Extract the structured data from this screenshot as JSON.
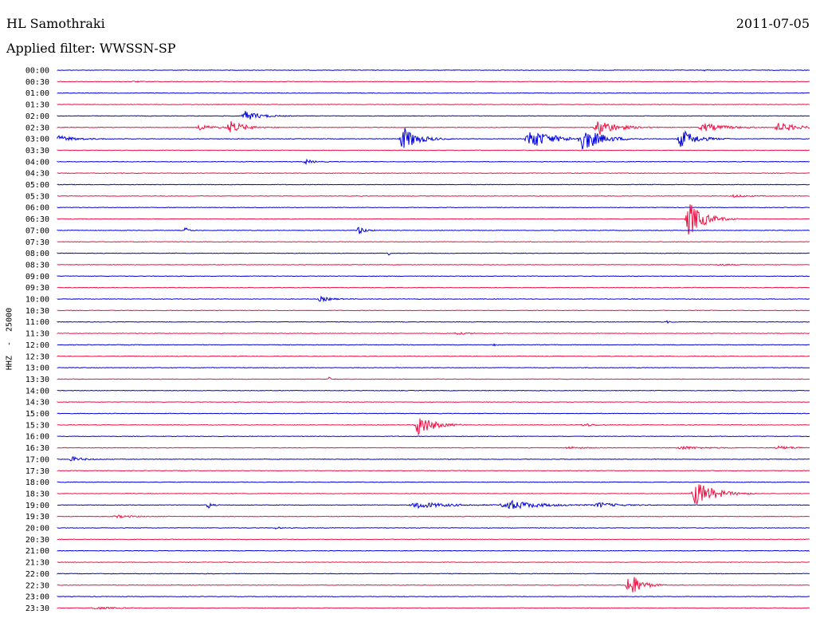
{
  "header": {
    "station": "HL Samothraki",
    "date": "2011-07-05",
    "filter": "Applied filter: WWSSN-SP"
  },
  "colors": {
    "blue": "#0000dd",
    "red": "#ee1144"
  },
  "chart_data": {
    "type": "helicorder",
    "channel_label": "HHZ  -  25000",
    "rows": [
      {
        "label": "00:00",
        "color": "blue",
        "bursts": [
          [
            0.86,
            0.8,
            0.01
          ]
        ]
      },
      {
        "label": "00:30",
        "color": "red",
        "bursts": [
          [
            0.1,
            0.5,
            0.05
          ]
        ]
      },
      {
        "label": "01:00",
        "color": "blue",
        "bursts": []
      },
      {
        "label": "01:30",
        "color": "red",
        "bursts": []
      },
      {
        "label": "02:00",
        "color": "blue",
        "bursts": [
          [
            0.25,
            6,
            0.04
          ]
        ]
      },
      {
        "label": "02:30",
        "color": "red",
        "bursts": [
          [
            0.23,
            8,
            0.04
          ],
          [
            0.19,
            3,
            0.04
          ],
          [
            0.72,
            10,
            0.05
          ],
          [
            0.86,
            5,
            0.06
          ],
          [
            0.96,
            6,
            0.05
          ]
        ]
      },
      {
        "label": "03:00",
        "color": "blue",
        "bursts": [
          [
            0.0,
            4,
            0.05
          ],
          [
            0.46,
            15,
            0.04
          ],
          [
            0.63,
            12,
            0.06
          ],
          [
            0.7,
            14,
            0.05
          ],
          [
            0.83,
            12,
            0.04
          ]
        ]
      },
      {
        "label": "03:30",
        "color": "red",
        "bursts": []
      },
      {
        "label": "04:00",
        "color": "blue",
        "bursts": [
          [
            0.33,
            3,
            0.02
          ]
        ]
      },
      {
        "label": "04:30",
        "color": "red",
        "bursts": []
      },
      {
        "label": "05:00",
        "color": "blue",
        "bursts": []
      },
      {
        "label": "05:30",
        "color": "red",
        "bursts": [
          [
            0.9,
            1.5,
            0.04
          ]
        ]
      },
      {
        "label": "06:00",
        "color": "blue",
        "bursts": []
      },
      {
        "label": "06:30",
        "color": "red",
        "bursts": [
          [
            0.84,
            22,
            0.04
          ]
        ]
      },
      {
        "label": "07:00",
        "color": "blue",
        "bursts": [
          [
            0.17,
            4,
            0.01
          ],
          [
            0.4,
            5,
            0.02
          ]
        ]
      },
      {
        "label": "07:30",
        "color": "red",
        "bursts": []
      },
      {
        "label": "08:00",
        "color": "blue",
        "bursts": [
          [
            0.44,
            3,
            0.005
          ]
        ]
      },
      {
        "label": "08:30",
        "color": "red",
        "bursts": [
          [
            0.88,
            1.5,
            0.03
          ]
        ]
      },
      {
        "label": "09:00",
        "color": "blue",
        "bursts": []
      },
      {
        "label": "09:30",
        "color": "red",
        "bursts": []
      },
      {
        "label": "10:00",
        "color": "blue",
        "bursts": [
          [
            0.35,
            3,
            0.03
          ]
        ]
      },
      {
        "label": "10:30",
        "color": "red",
        "bursts": []
      },
      {
        "label": "11:00",
        "color": "blue",
        "bursts": [
          [
            0.81,
            1.5,
            0.01
          ]
        ]
      },
      {
        "label": "11:30",
        "color": "red",
        "bursts": [
          [
            0.53,
            1.5,
            0.03
          ]
        ]
      },
      {
        "label": "12:00",
        "color": "blue",
        "bursts": [
          [
            0.58,
            1.5,
            0.01
          ]
        ]
      },
      {
        "label": "12:30",
        "color": "red",
        "bursts": []
      },
      {
        "label": "13:00",
        "color": "blue",
        "bursts": []
      },
      {
        "label": "13:30",
        "color": "red",
        "bursts": [
          [
            0.36,
            3,
            0.01
          ]
        ]
      },
      {
        "label": "14:00",
        "color": "blue",
        "bursts": []
      },
      {
        "label": "14:30",
        "color": "red",
        "bursts": []
      },
      {
        "label": "15:00",
        "color": "blue",
        "bursts": []
      },
      {
        "label": "15:30",
        "color": "red",
        "bursts": [
          [
            0.48,
            14,
            0.04
          ],
          [
            0.7,
            2,
            0.03
          ]
        ]
      },
      {
        "label": "16:00",
        "color": "blue",
        "bursts": []
      },
      {
        "label": "16:30",
        "color": "red",
        "bursts": [
          [
            0.68,
            1.5,
            0.04
          ],
          [
            0.83,
            2,
            0.06
          ],
          [
            0.96,
            2,
            0.05
          ]
        ]
      },
      {
        "label": "17:00",
        "color": "blue",
        "bursts": [
          [
            0.02,
            3,
            0.03
          ]
        ]
      },
      {
        "label": "17:30",
        "color": "red",
        "bursts": []
      },
      {
        "label": "18:00",
        "color": "blue",
        "bursts": []
      },
      {
        "label": "18:30",
        "color": "red",
        "bursts": [
          [
            0.85,
            16,
            0.05
          ]
        ]
      },
      {
        "label": "19:00",
        "color": "blue",
        "bursts": [
          [
            0.2,
            5,
            0.01
          ],
          [
            0.48,
            4,
            0.08
          ],
          [
            0.6,
            6,
            0.08
          ],
          [
            0.72,
            3,
            0.05
          ]
        ]
      },
      {
        "label": "19:30",
        "color": "red",
        "bursts": [
          [
            0.08,
            1.5,
            0.05
          ]
        ]
      },
      {
        "label": "20:00",
        "color": "blue",
        "bursts": [
          [
            0.29,
            2,
            0.01
          ]
        ]
      },
      {
        "label": "20:30",
        "color": "red",
        "bursts": []
      },
      {
        "label": "21:00",
        "color": "blue",
        "bursts": []
      },
      {
        "label": "21:30",
        "color": "red",
        "bursts": []
      },
      {
        "label": "22:00",
        "color": "blue",
        "bursts": []
      },
      {
        "label": "22:30",
        "color": "red",
        "bursts": [
          [
            0.76,
            18,
            0.03
          ]
        ]
      },
      {
        "label": "23:00",
        "color": "blue",
        "bursts": []
      },
      {
        "label": "23:30",
        "color": "red",
        "bursts": [
          [
            0.05,
            1.5,
            0.05
          ]
        ]
      }
    ]
  }
}
